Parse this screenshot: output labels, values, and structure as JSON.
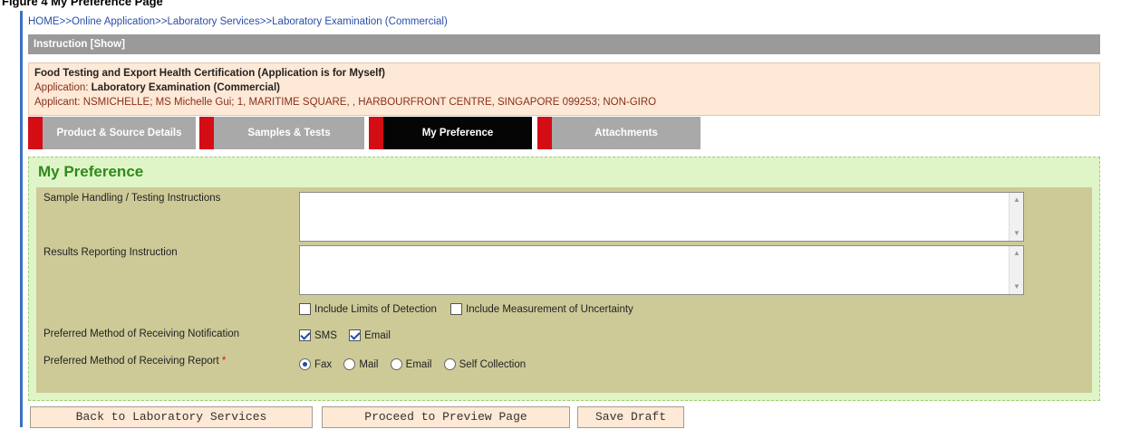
{
  "caption": "Figure 4 My Preference Page",
  "breadcrumb": [
    "HOME",
    ">>",
    "Online Application",
    ">>",
    "Laboratory Services",
    ">>",
    "Laboratory Examination (Commercial)"
  ],
  "instruction_bar": "Instruction [Show]",
  "app_info": {
    "title": "Food Testing and Export Health Certification (Application is for Myself)",
    "application_label": "Application: ",
    "application_value": "Laboratory Examination (Commercial)",
    "applicant_label": "Applicant: ",
    "applicant_value": "NSMICHELLE; MS Michelle Gui; 1, MARITIME SQUARE, , HARBOURFRONT CENTRE, SINGAPORE 099253; NON-GIRO"
  },
  "tabs": [
    {
      "label": "Product & Source Details",
      "active": false
    },
    {
      "label": "Samples & Tests",
      "active": false
    },
    {
      "label": "My Preference",
      "active": true
    },
    {
      "label": "Attachments",
      "active": false
    }
  ],
  "section": {
    "title": "My Preference",
    "sample_handling_label": "Sample Handling / Testing Instructions",
    "sample_handling_value": "",
    "results_reporting_label": "Results Reporting Instruction",
    "results_reporting_value": "",
    "include_limits_label": "Include Limits of Detection",
    "include_limits_checked": false,
    "include_uncertainty_label": "Include Measurement of Uncertainty",
    "include_uncertainty_checked": false,
    "notification_label": "Preferred Method of Receiving Notification",
    "notification_options": [
      {
        "label": "SMS",
        "checked": true
      },
      {
        "label": "Email",
        "checked": true
      }
    ],
    "report_label": "Preferred Method of Receiving Report",
    "required_mark": "*",
    "report_options": [
      {
        "label": "Fax",
        "selected": true
      },
      {
        "label": "Mail",
        "selected": false
      },
      {
        "label": "Email",
        "selected": false
      },
      {
        "label": "Self Collection",
        "selected": false
      }
    ]
  },
  "buttons": {
    "back": "Back to Laboratory Services",
    "proceed": "Proceed to Preview Page",
    "save": "Save Draft"
  },
  "colors": {
    "tab_marker": "#d40d15",
    "active_tab": "#050505",
    "section_title": "#2f8a1a",
    "form_bg": "#cdca98"
  }
}
